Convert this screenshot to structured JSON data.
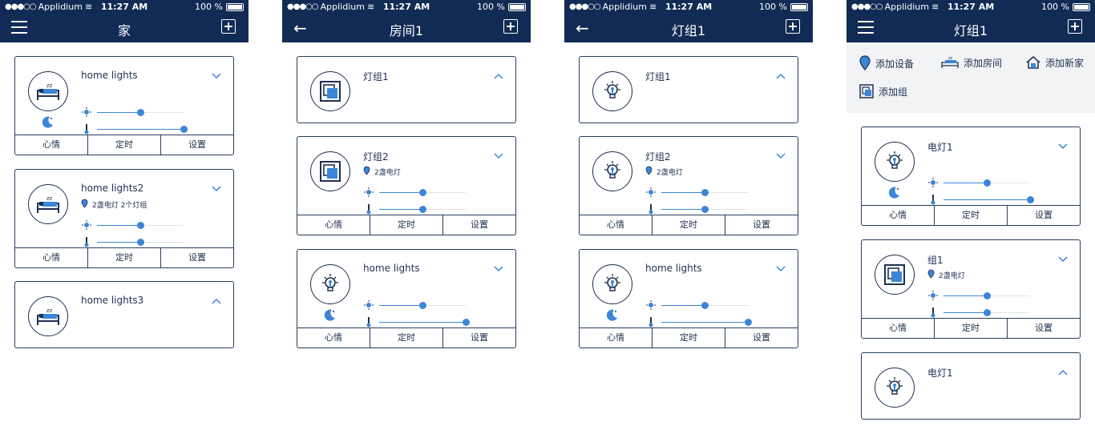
{
  "status": {
    "carrier": "Applidium",
    "time": "11:27 AM",
    "battery": "100 %"
  },
  "colors": {
    "navy": "#112b55",
    "accent": "#3d85d6",
    "text": "#1f3050"
  },
  "tab_labels": {
    "mood": "心情",
    "timer": "定时",
    "settings": "设置"
  },
  "screens": [
    {
      "title": "家",
      "left_icon": "menu-icon",
      "cards": [
        {
          "name": "home lights",
          "icon": "bed-icon",
          "expanded": true,
          "info": "",
          "sliders": [
            0.5,
            1.0
          ],
          "has_moon": true
        },
        {
          "name": "home lights2",
          "icon": "bed-icon",
          "expanded": true,
          "info": "2盏电灯  2个灯组",
          "sliders": [
            0.5,
            0.5
          ],
          "has_moon": false
        },
        {
          "name": "home lights3",
          "icon": "bed-icon",
          "expanded": false
        }
      ]
    },
    {
      "title": "房间1",
      "left_icon": "back-icon",
      "cards": [
        {
          "name": "灯组1",
          "icon": "group-icon",
          "expanded": false
        },
        {
          "name": "灯组2",
          "icon": "group-icon",
          "expanded": true,
          "info": "2盏电灯",
          "sliders": [
            0.5,
            0.5
          ],
          "has_moon": false
        },
        {
          "name": "home lights",
          "icon": "bulb-icon",
          "expanded": true,
          "info": "",
          "sliders": [
            0.5,
            1.0
          ],
          "has_moon": true
        }
      ]
    },
    {
      "title": "灯组1",
      "left_icon": "back-icon",
      "cards": [
        {
          "name": "灯组1",
          "icon": "bulb-icon",
          "expanded": false
        },
        {
          "name": "灯组2",
          "icon": "bulb-icon",
          "expanded": true,
          "info": "2盏电灯",
          "sliders": [
            0.5,
            0.5
          ],
          "has_moon": false
        },
        {
          "name": "home lights",
          "icon": "bulb-icon",
          "expanded": true,
          "info": "",
          "sliders": [
            0.5,
            1.0
          ],
          "has_moon": true
        }
      ]
    },
    {
      "title": "灯组1",
      "left_icon": "menu-icon",
      "add_menu": {
        "add_device": "添加设备",
        "add_room": "添加房间",
        "add_home": "添加新家",
        "add_group": "添加组"
      },
      "cards": [
        {
          "name": "电灯1",
          "icon": "bulb-icon",
          "expanded": true,
          "info": "",
          "sliders": [
            0.5,
            1.0
          ],
          "has_moon": true
        },
        {
          "name": "组1",
          "icon": "group-icon",
          "expanded": true,
          "info": "2盏电灯",
          "sliders": [
            0.5,
            0.5
          ],
          "has_moon": false
        },
        {
          "name": "电灯1",
          "icon": "bulb-icon",
          "expanded": false
        }
      ]
    }
  ]
}
